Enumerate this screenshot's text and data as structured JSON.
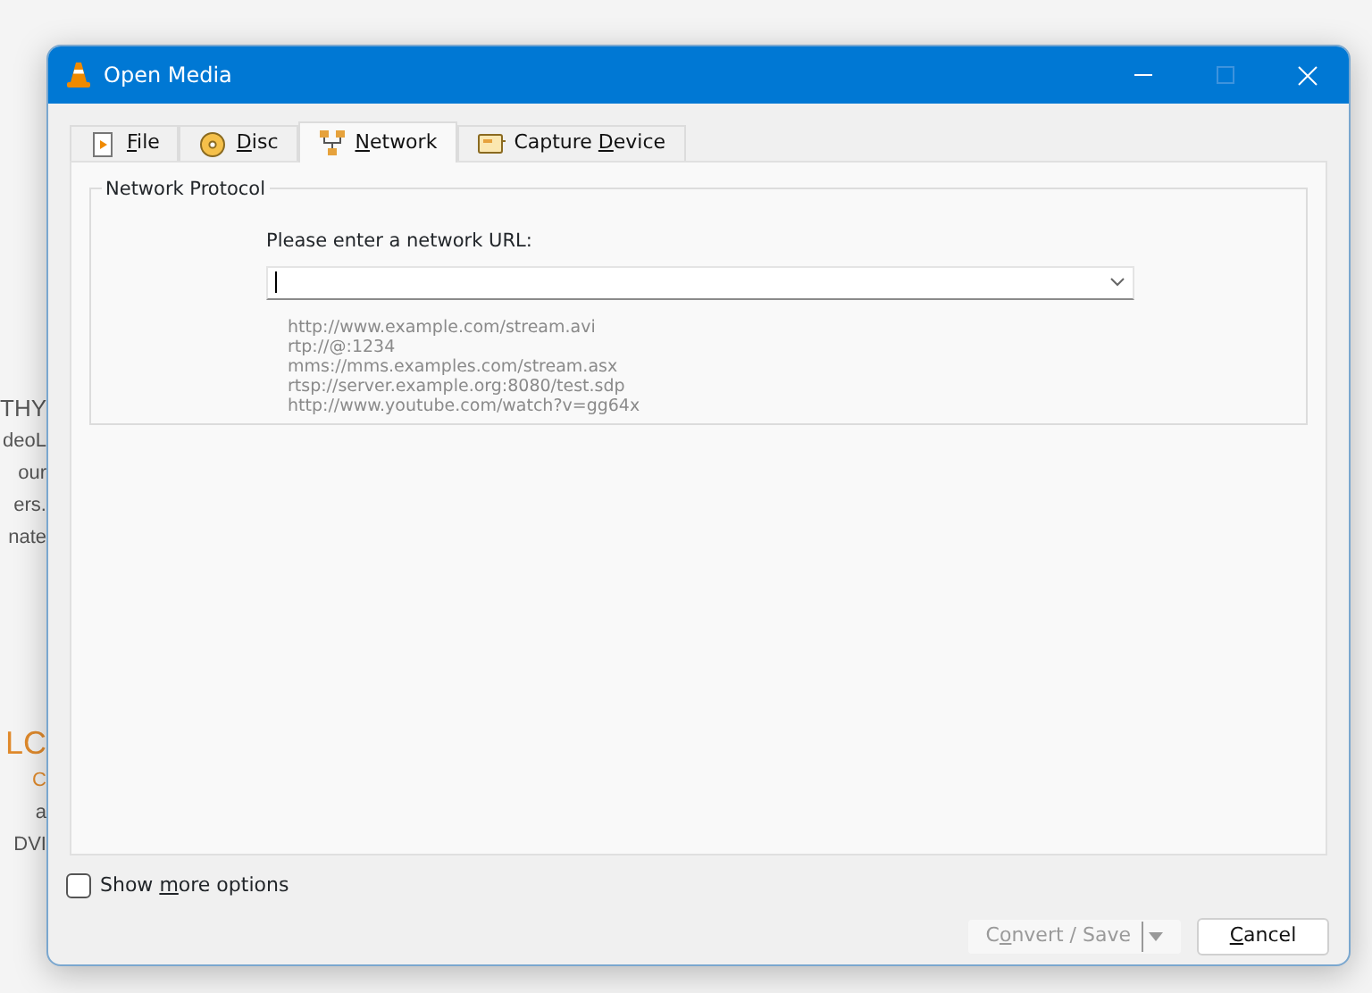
{
  "background_page": {
    "fragments": [
      {
        "text": "THY",
        "kind": "heading",
        "color": "#555555"
      },
      {
        "text": "deoL",
        "kind": "body",
        "color": "#555555"
      },
      {
        "text": "our",
        "kind": "body",
        "color": "#555555"
      },
      {
        "text": "ers.",
        "kind": "body",
        "color": "#555555"
      },
      {
        "text": "nate",
        "kind": "body",
        "color": "#555555"
      },
      {
        "text": "LC",
        "kind": "heading",
        "color": "#e08a2c"
      },
      {
        "text": "C",
        "kind": "body",
        "color": "#e08a2c"
      },
      {
        "text": "a",
        "kind": "body",
        "color": "#555555"
      },
      {
        "text": "DVI",
        "kind": "body",
        "color": "#555555"
      }
    ]
  },
  "window": {
    "title": "Open Media",
    "controls": [
      {
        "kind": "minimize",
        "disabled": false
      },
      {
        "kind": "maximize",
        "disabled": true
      },
      {
        "kind": "close",
        "disabled": false
      }
    ]
  },
  "tabs": [
    {
      "kind": "file",
      "key": "F",
      "post": "ile",
      "selected": false
    },
    {
      "kind": "disc",
      "key": "D",
      "post": "isc",
      "selected": false
    },
    {
      "kind": "network",
      "key": "N",
      "post": "etwork",
      "selected": true
    },
    {
      "kind": "capture",
      "pre": "Capture ",
      "key": "D",
      "post": "evice",
      "selected": false
    }
  ],
  "network_protocol": {
    "title": "Network Protocol",
    "prompt": "Please enter a network URL:",
    "examples": [
      "http://www.example.com/stream.avi",
      "rtp://@:1234",
      "mms://mms.examples.com/stream.asx",
      "rtsp://server.example.org:8080/test.sdp",
      "http://www.youtube.com/watch?v=gg64x"
    ]
  },
  "show_more_options": {
    "pre": "Show ",
    "key": "m",
    "post": "ore options",
    "checked": false
  },
  "buttons": [
    {
      "kind": "split",
      "pre": "C",
      "key": "o",
      "post": "nvert / Save",
      "disabled": true
    },
    {
      "kind": "plain",
      "key": "C",
      "post": "ancel",
      "disabled": false
    }
  ]
}
